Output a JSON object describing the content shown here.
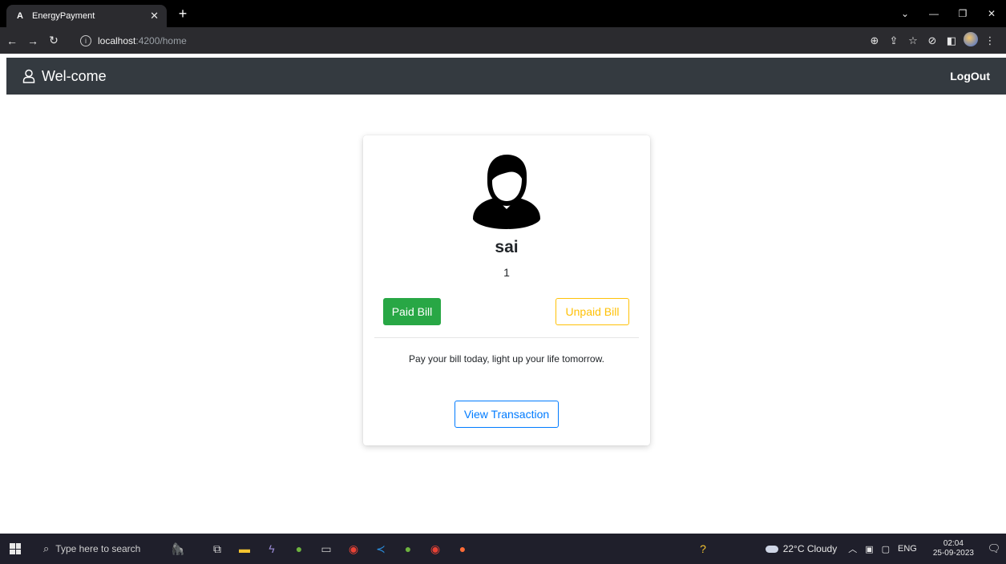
{
  "browser": {
    "tab_title": "EnergyPayment",
    "tab_favicon_letter": "A",
    "url_host": "localhost",
    "url_path": ":4200/home"
  },
  "navbar": {
    "brand": "Wel-come",
    "logout": "LogOut"
  },
  "profile": {
    "name": "sai",
    "id": "1"
  },
  "buttons": {
    "paid": "Paid Bill",
    "unpaid": "Unpaid Bill",
    "view": "View Transaction"
  },
  "tagline": "Pay your bill today, light up your life tomorrow.",
  "taskbar": {
    "search_placeholder": "Type here to search",
    "weather": "22°C  Cloudy",
    "lang": "ENG",
    "time": "02:04",
    "date": "25-09-2023"
  },
  "colors": {
    "navbar_bg": "#343a40",
    "success": "#28a745",
    "warning": "#ffc107",
    "primary": "#007bff"
  }
}
